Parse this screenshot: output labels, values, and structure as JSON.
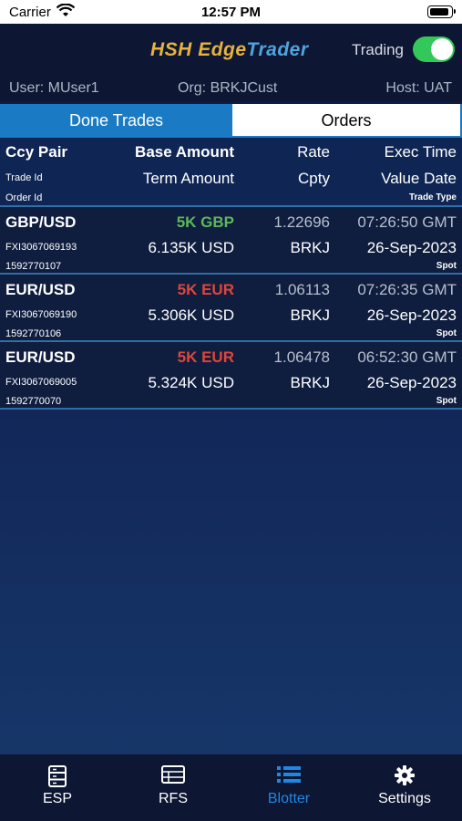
{
  "status_bar": {
    "carrier": "Carrier",
    "time": "12:57 PM",
    "battery_level": 0.85
  },
  "header": {
    "logo": {
      "part1": "HSH ",
      "part2": "Edge",
      "part3": "Trader"
    },
    "trading_label": "Trading",
    "trading_enabled": true,
    "user": "User: MUser1",
    "org": "Org: BRKJCust",
    "host": "Host: UAT"
  },
  "tabs": [
    {
      "label": "Done Trades",
      "active": true
    },
    {
      "label": "Orders",
      "active": false
    }
  ],
  "columns": {
    "ccy_pair": "Ccy Pair",
    "base_amount": "Base Amount",
    "rate": "Rate",
    "exec_time": "Exec Time",
    "trade_id": "Trade Id",
    "term_amount": "Term Amount",
    "cpty": "Cpty",
    "value_date": "Value Date",
    "order_id": "Order Id",
    "trade_type": "Trade Type"
  },
  "trades": [
    {
      "ccy_pair": "GBP/USD",
      "base_amount": "5K GBP",
      "side_color": "#5cb85c",
      "rate": "1.22696",
      "exec_time": "07:26:50 GMT",
      "trade_id": "FXI3067069193",
      "term_amount": "6.135K USD",
      "cpty": "BRKJ",
      "value_date": "26-Sep-2023",
      "order_id": "1592770107",
      "trade_type": "Spot"
    },
    {
      "ccy_pair": "EUR/USD",
      "base_amount": "5K EUR",
      "side_color": "#e0453a",
      "rate": "1.06113",
      "exec_time": "07:26:35 GMT",
      "trade_id": "FXI3067069190",
      "term_amount": "5.306K USD",
      "cpty": "BRKJ",
      "value_date": "26-Sep-2023",
      "order_id": "1592770106",
      "trade_type": "Spot"
    },
    {
      "ccy_pair": "EUR/USD",
      "base_amount": "5K EUR",
      "side_color": "#e0453a",
      "rate": "1.06478",
      "exec_time": "06:52:30 GMT",
      "trade_id": "FXI3067069005",
      "term_amount": "5.324K USD",
      "cpty": "BRKJ",
      "value_date": "26-Sep-2023",
      "order_id": "1592770070",
      "trade_type": "Spot"
    }
  ],
  "tab_bar": [
    {
      "label": "ESP",
      "icon": "server-icon",
      "active": false
    },
    {
      "label": "RFS",
      "icon": "table-icon",
      "active": false
    },
    {
      "label": "Blotter",
      "icon": "list-icon",
      "active": true
    },
    {
      "label": "Settings",
      "icon": "gear-icon",
      "active": false
    }
  ]
}
